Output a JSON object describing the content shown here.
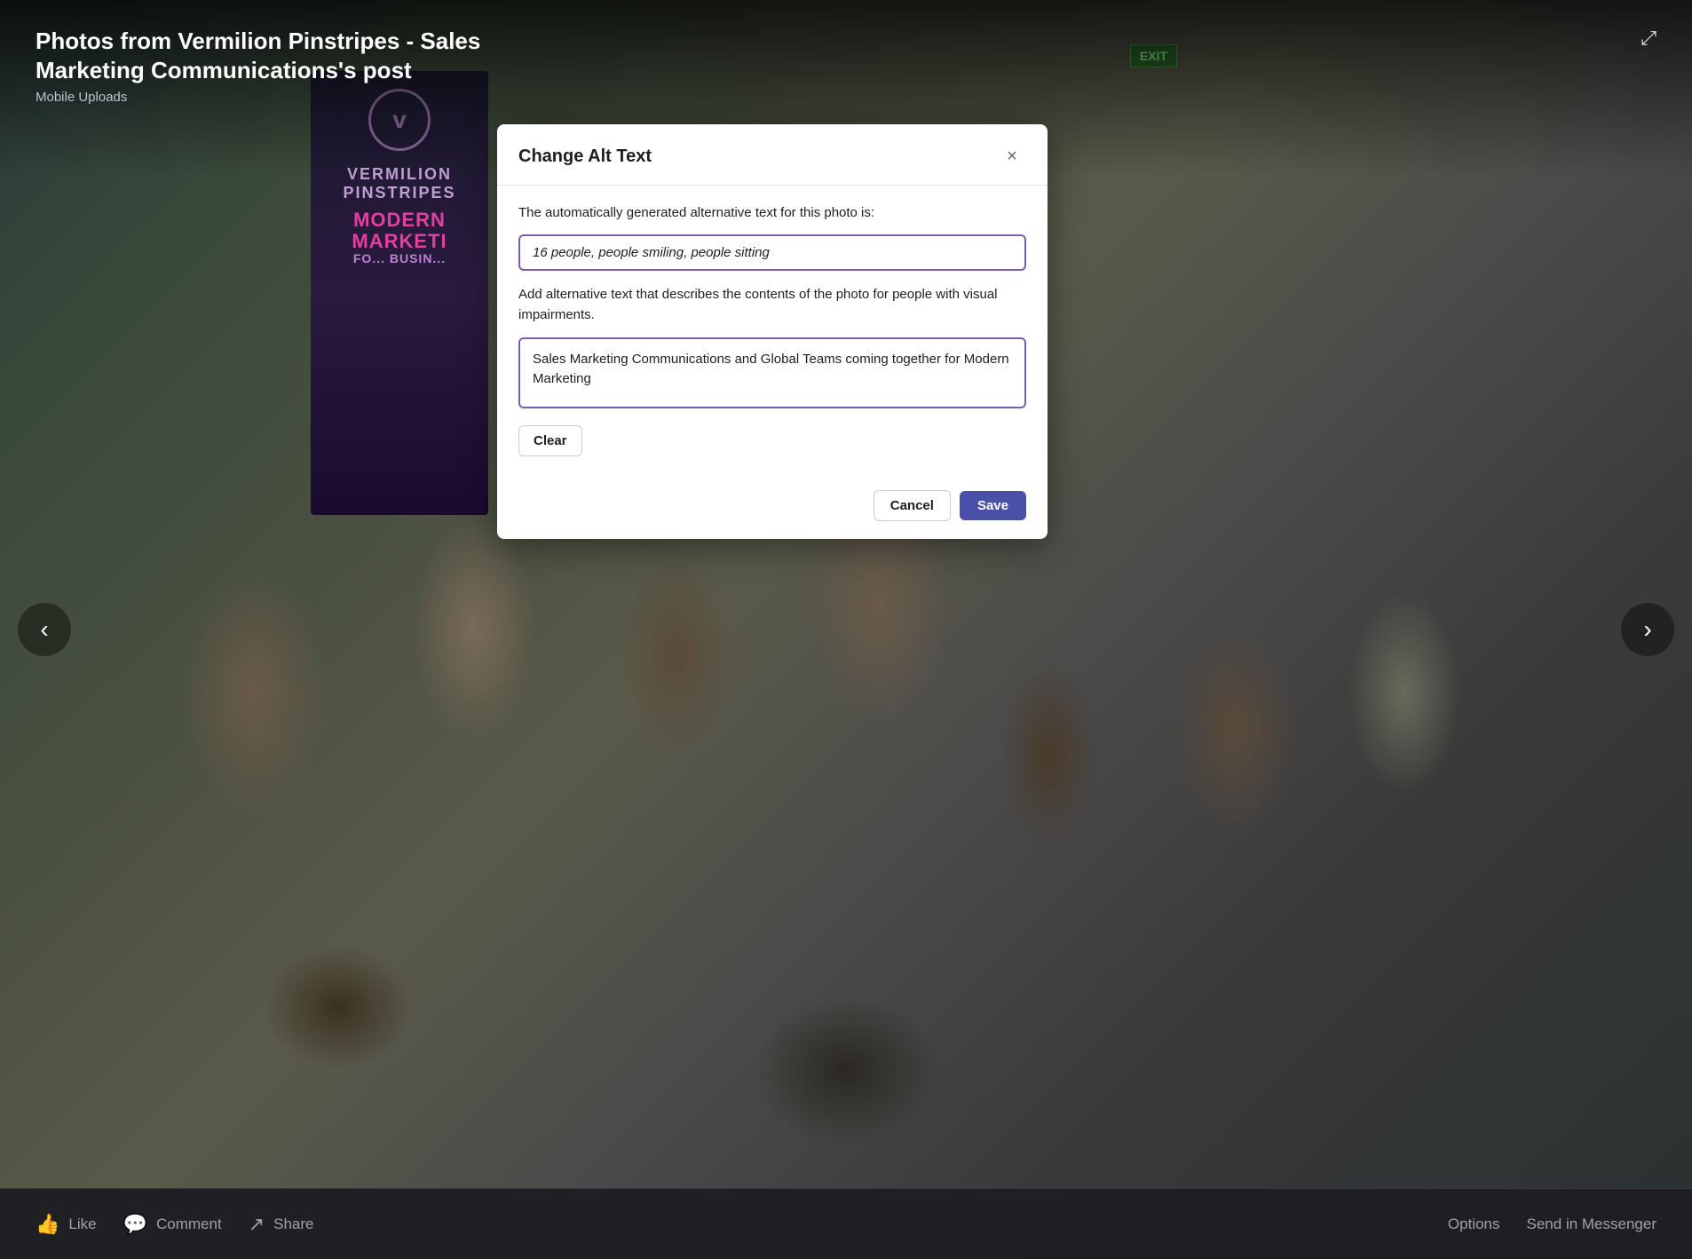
{
  "page": {
    "title": "Photos from Vermilion Pinstripes - Sales Marketing Communications's post",
    "subtitle": "Mobile Uploads"
  },
  "background": {
    "exit_sign": "EXIT"
  },
  "banner": {
    "logo_letter": "v",
    "company_line1": "vermilion",
    "company_line2": "PINSTRIPES",
    "tagline_line1": "MODERN",
    "tagline_line2": "MARKETI",
    "tagline_line3": "FO... BUSIN..."
  },
  "nav": {
    "left_arrow": "‹",
    "right_arrow": "›"
  },
  "bottom_bar": {
    "like_label": "Like",
    "comment_label": "Comment",
    "share_label": "Share",
    "options_label": "Options",
    "messenger_label": "Send in Messenger"
  },
  "modal": {
    "title": "Change Alt Text",
    "close_icon": "×",
    "description": "The automatically generated alternative text for this photo is:",
    "auto_alt": "16 people, people smiling, people sitting",
    "instructions": "Add alternative text that describes the contents of the photo for people with visual impairments.",
    "textarea_value": "Sales Marketing Communications and Global Teams coming together for Modern Marketing",
    "clear_label": "Clear",
    "cancel_label": "Cancel",
    "save_label": "Save"
  },
  "expand_icon": "⤢"
}
